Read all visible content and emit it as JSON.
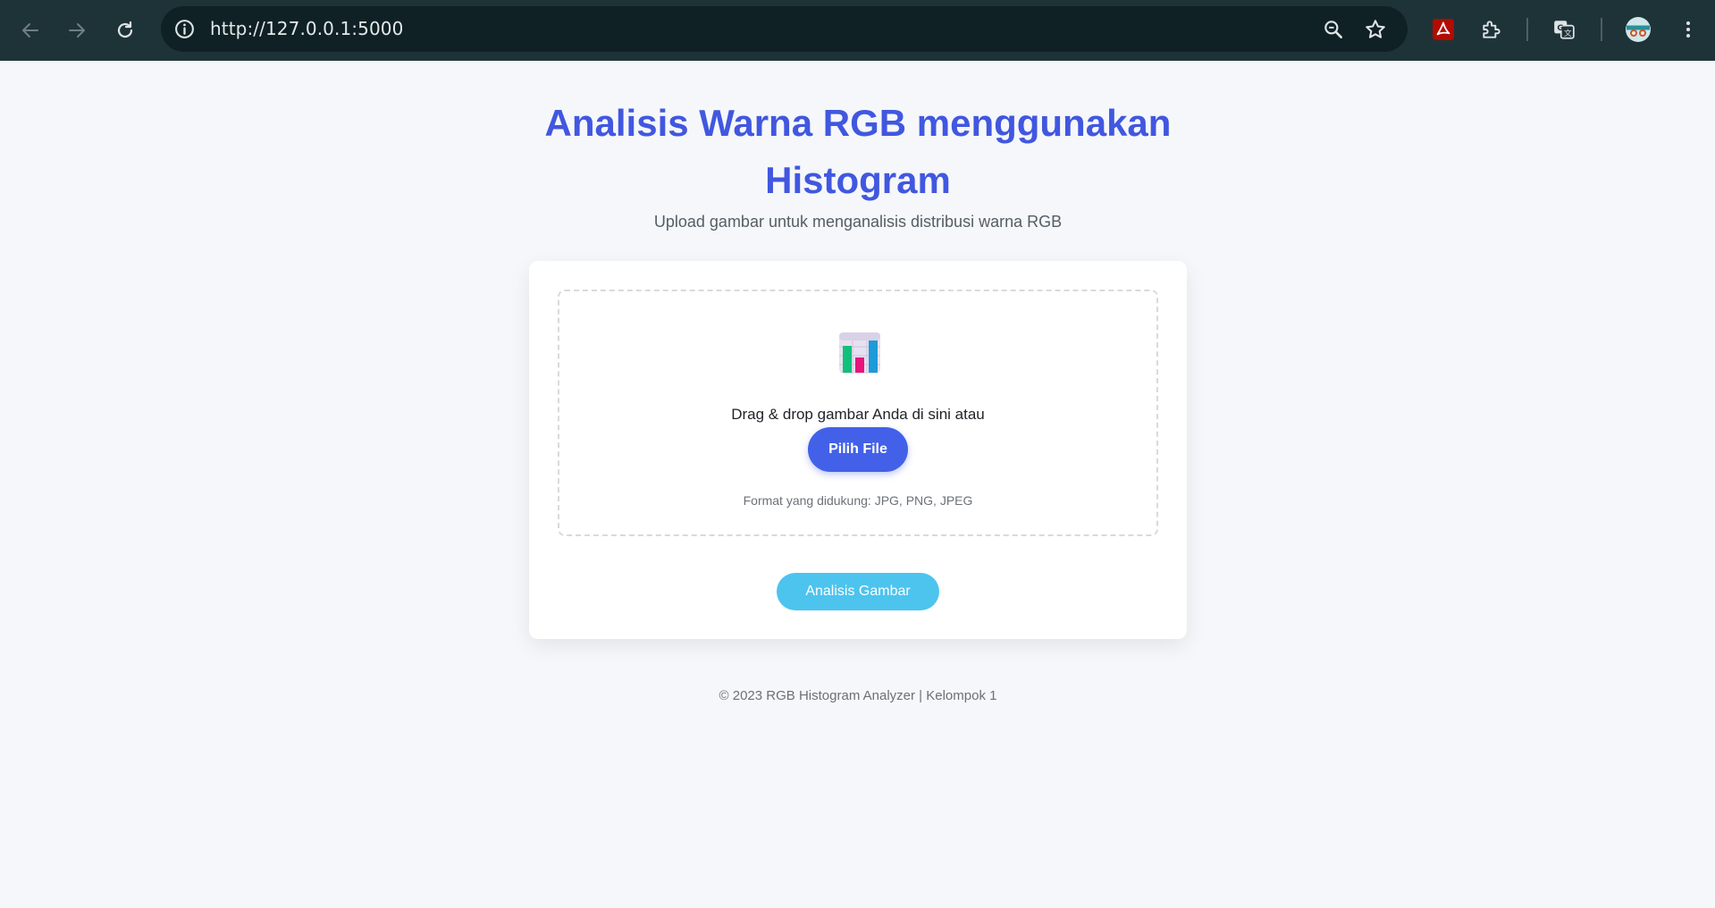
{
  "browser": {
    "url": "http://127.0.0.1:5000"
  },
  "page": {
    "title": "Analisis Warna RGB menggunakan Histogram",
    "subtitle": "Upload gambar untuk menganalisis distribusi warna RGB",
    "upload": {
      "drop_text": "Drag & drop gambar Anda di sini atau",
      "pick_label": "Pilih File",
      "formats": "Format yang didukung: JPG, PNG, JPEG"
    },
    "analyze_label": "Analisis Gambar",
    "footer": "© 2023 RGB Histogram Analyzer | Kelompok 1"
  },
  "colors": {
    "accent": "#4157e0",
    "button": "#4361e8",
    "analyze": "#4cc4ee",
    "toolbar": "#1e3338"
  }
}
